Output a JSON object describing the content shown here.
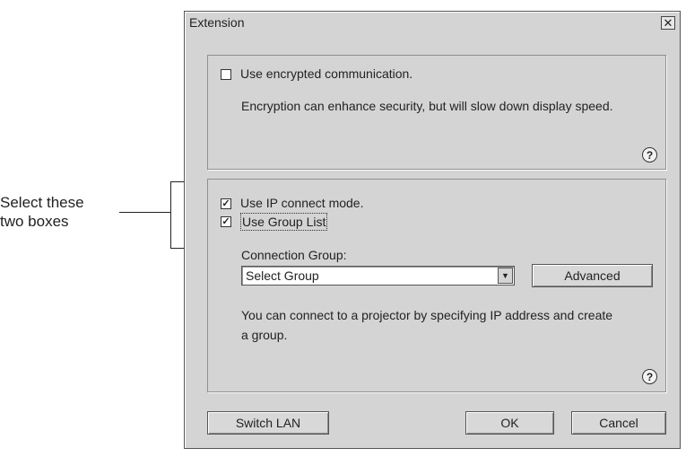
{
  "callout": {
    "text_line1": "Select these",
    "text_line2": "two boxes"
  },
  "dialog": {
    "title": "Extension",
    "close_glyph": "✕",
    "encryption": {
      "checkbox_label": "Use encrypted communication.",
      "checked": false,
      "description": "Encryption can enhance security, but will slow down display speed."
    },
    "ip": {
      "ip_connect_label": "Use IP connect mode.",
      "ip_connect_checked": true,
      "group_list_label": "Use Group List",
      "group_list_checked": true,
      "connection_group_label": "Connection Group:",
      "connection_group_value": "Select Group",
      "advanced_button": "Advanced",
      "description": "You can connect to a projector by specifying IP address and create a group."
    },
    "help_glyph": "?",
    "check_glyph": "✓",
    "buttons": {
      "switch_lan": "Switch LAN",
      "ok": "OK",
      "cancel": "Cancel"
    }
  }
}
